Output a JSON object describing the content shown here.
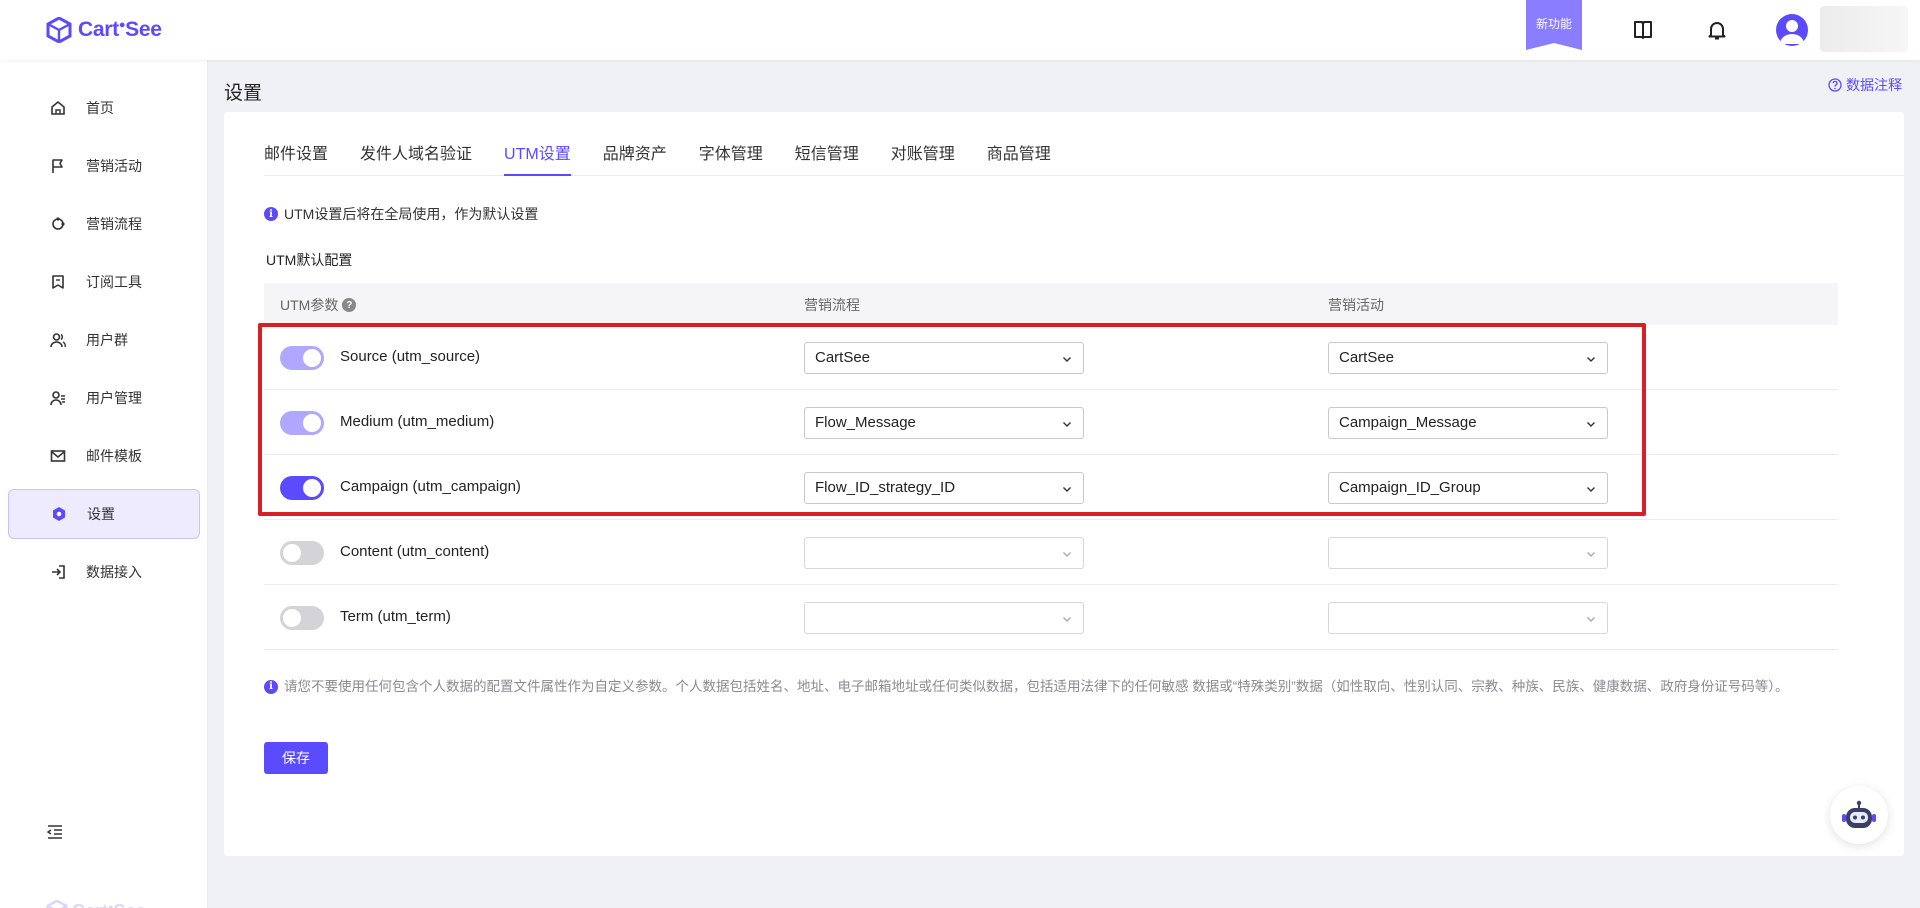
{
  "brand": {
    "name": "Cart",
    "name_suffix": "See",
    "color": "#5b4bff"
  },
  "topbar": {
    "new_feature": "新功能"
  },
  "sidebar": {
    "items": [
      {
        "label": "首页",
        "icon": "home-icon"
      },
      {
        "label": "营销活动",
        "icon": "flag-icon"
      },
      {
        "label": "营销流程",
        "icon": "flow-icon"
      },
      {
        "label": "订阅工具",
        "icon": "bookmark-icon"
      },
      {
        "label": "用户群",
        "icon": "users-icon"
      },
      {
        "label": "用户管理",
        "icon": "user-manage-icon"
      },
      {
        "label": "邮件模板",
        "icon": "mail-icon"
      },
      {
        "label": "设置",
        "icon": "settings-icon",
        "active": true
      },
      {
        "label": "数据接入",
        "icon": "import-icon"
      }
    ]
  },
  "page": {
    "title": "设置",
    "data_note": "数据注释"
  },
  "tabs": [
    {
      "label": "邮件设置"
    },
    {
      "label": "发件人域名验证"
    },
    {
      "label": "UTM设置",
      "active": true
    },
    {
      "label": "品牌资产"
    },
    {
      "label": "字体管理"
    },
    {
      "label": "短信管理"
    },
    {
      "label": "对账管理"
    },
    {
      "label": "商品管理"
    }
  ],
  "info": "UTM设置后将在全局使用，作为默认设置",
  "section_title": "UTM默认配置",
  "table": {
    "headers": [
      "UTM参数",
      "营销流程",
      "营销活动"
    ],
    "rows": [
      {
        "param": "Source (utm_source)",
        "enabled": true,
        "flow": "CartSee",
        "campaign": "CartSee"
      },
      {
        "param": "Medium (utm_medium)",
        "enabled": true,
        "flow": "Flow_Message",
        "campaign": "Campaign_Message"
      },
      {
        "param": "Campaign (utm_campaign)",
        "enabled": true,
        "flow": "Flow_ID_strategy_ID",
        "campaign": "Campaign_ID_Group"
      },
      {
        "param": "Content (utm_content)",
        "enabled": false,
        "flow": "",
        "campaign": ""
      },
      {
        "param": "Term (utm_term)",
        "enabled": false,
        "flow": "",
        "campaign": ""
      }
    ]
  },
  "notice": "请您不要使用任何包含个人数据的配置文件属性作为自定义参数。个人数据包括姓名、地址、电子邮箱地址或任何类似数据，包括适用法律下的任何敏感 数据或“特殊类别”数据（如性取向、性别认同、宗教、种族、民族、健康数据、政府身份证号码等）。",
  "save_label": "保存",
  "colors": {
    "accent": "#5b4bff",
    "highlight": "#d91f26",
    "toggle_on_disabled": "#b0a8ff"
  }
}
